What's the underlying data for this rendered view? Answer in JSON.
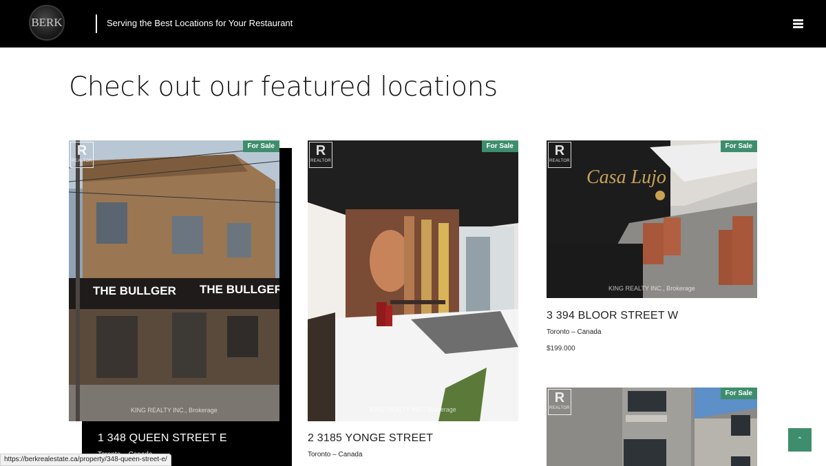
{
  "header": {
    "logo_text": "BERK",
    "tagline": "Serving the Best Locations for Your Restaurant",
    "menu_icon": "hamburger-menu-icon"
  },
  "main": {
    "title": "Check out our featured locations"
  },
  "listings": [
    {
      "badge": "For Sale",
      "realtor_mark": "R",
      "realtor_text": "REALTOR",
      "watermark": "KING REALTY INC., Brokerage",
      "address": "1 348 QUEEN STREET E",
      "location": "Toronto – Canada",
      "price": ""
    },
    {
      "badge": "For Sale",
      "realtor_mark": "R",
      "realtor_text": "REALTOR",
      "watermark": "KING REALTY INC., Brokerage",
      "address": "2 3185 YONGE STREET",
      "location": "Toronto – Canada",
      "price": ""
    },
    {
      "badge": "For Sale",
      "realtor_mark": "R",
      "realtor_text": "REALTOR",
      "watermark": "KING REALTY INC., Brokerage",
      "address": "3 394 BLOOR STREET W",
      "location": "Toronto – Canada",
      "price": "$199.000"
    },
    {
      "badge": "For Sale",
      "realtor_mark": "R",
      "realtor_text": "REALTOR",
      "watermark": "",
      "address": "",
      "location": "",
      "price": ""
    }
  ],
  "scroll_top_icon": "chevron-up-icon",
  "scroll_top_glyph": "⌃",
  "status_bar": {
    "url": "https://berkrealestate.ca/property/348-queen-street-e/"
  },
  "colors": {
    "header_bg": "#000000",
    "accent": "#3e8e6e",
    "active_card_bg": "#000000"
  }
}
